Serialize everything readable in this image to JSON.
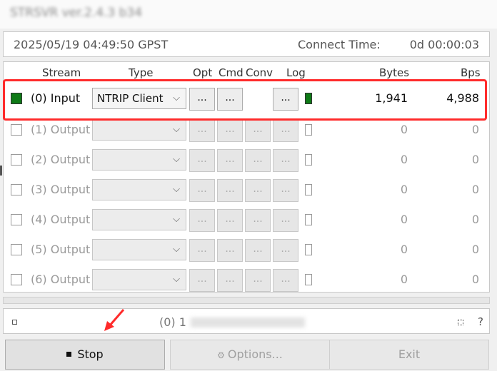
{
  "window": {
    "title": "STRSVR ver.2.4.3 b34"
  },
  "status": {
    "time": "2025/05/19 04:49:50 GPST",
    "connect_label": "Connect Time:",
    "connect_value": "0d 00:00:03"
  },
  "headers": {
    "stream": "Stream",
    "type": "Type",
    "opt": "Opt",
    "cmd": "Cmd",
    "conv": "Conv",
    "log": "Log",
    "bytes": "Bytes",
    "bps": "Bps"
  },
  "rows": [
    {
      "label": "(0) Input",
      "type": "NTRIP Client",
      "bytes": "1,941",
      "bps": "4,988",
      "opt": "...",
      "cmd": "...",
      "conv": "...",
      "log": "..."
    },
    {
      "label": "(1) Output",
      "type": "",
      "bytes": "0",
      "bps": "0",
      "opt": "...",
      "cmd": "...",
      "conv": "...",
      "log": "..."
    },
    {
      "label": "(2) Output",
      "type": "",
      "bytes": "0",
      "bps": "0",
      "opt": "...",
      "cmd": "...",
      "conv": "...",
      "log": "..."
    },
    {
      "label": "(3) Output",
      "type": "",
      "bytes": "0",
      "bps": "0",
      "opt": "...",
      "cmd": "...",
      "conv": "...",
      "log": "..."
    },
    {
      "label": "(4) Output",
      "type": "",
      "bytes": "0",
      "bps": "0",
      "opt": "...",
      "cmd": "...",
      "conv": "...",
      "log": "..."
    },
    {
      "label": "(5) Output",
      "type": "",
      "bytes": "0",
      "bps": "0",
      "opt": "...",
      "cmd": "...",
      "conv": "...",
      "log": "..."
    },
    {
      "label": "(6) Output",
      "type": "",
      "bytes": "0",
      "bps": "0",
      "opt": "...",
      "cmd": "...",
      "conv": "...",
      "log": "..."
    }
  ],
  "message": {
    "text": "(0) 1",
    "help": "?"
  },
  "buttons": {
    "stop": "Stop",
    "options": "Options...",
    "exit": "Exit"
  },
  "colors": {
    "active_indicator": "#0e7a16",
    "highlight_box": "#ff2b2b"
  }
}
